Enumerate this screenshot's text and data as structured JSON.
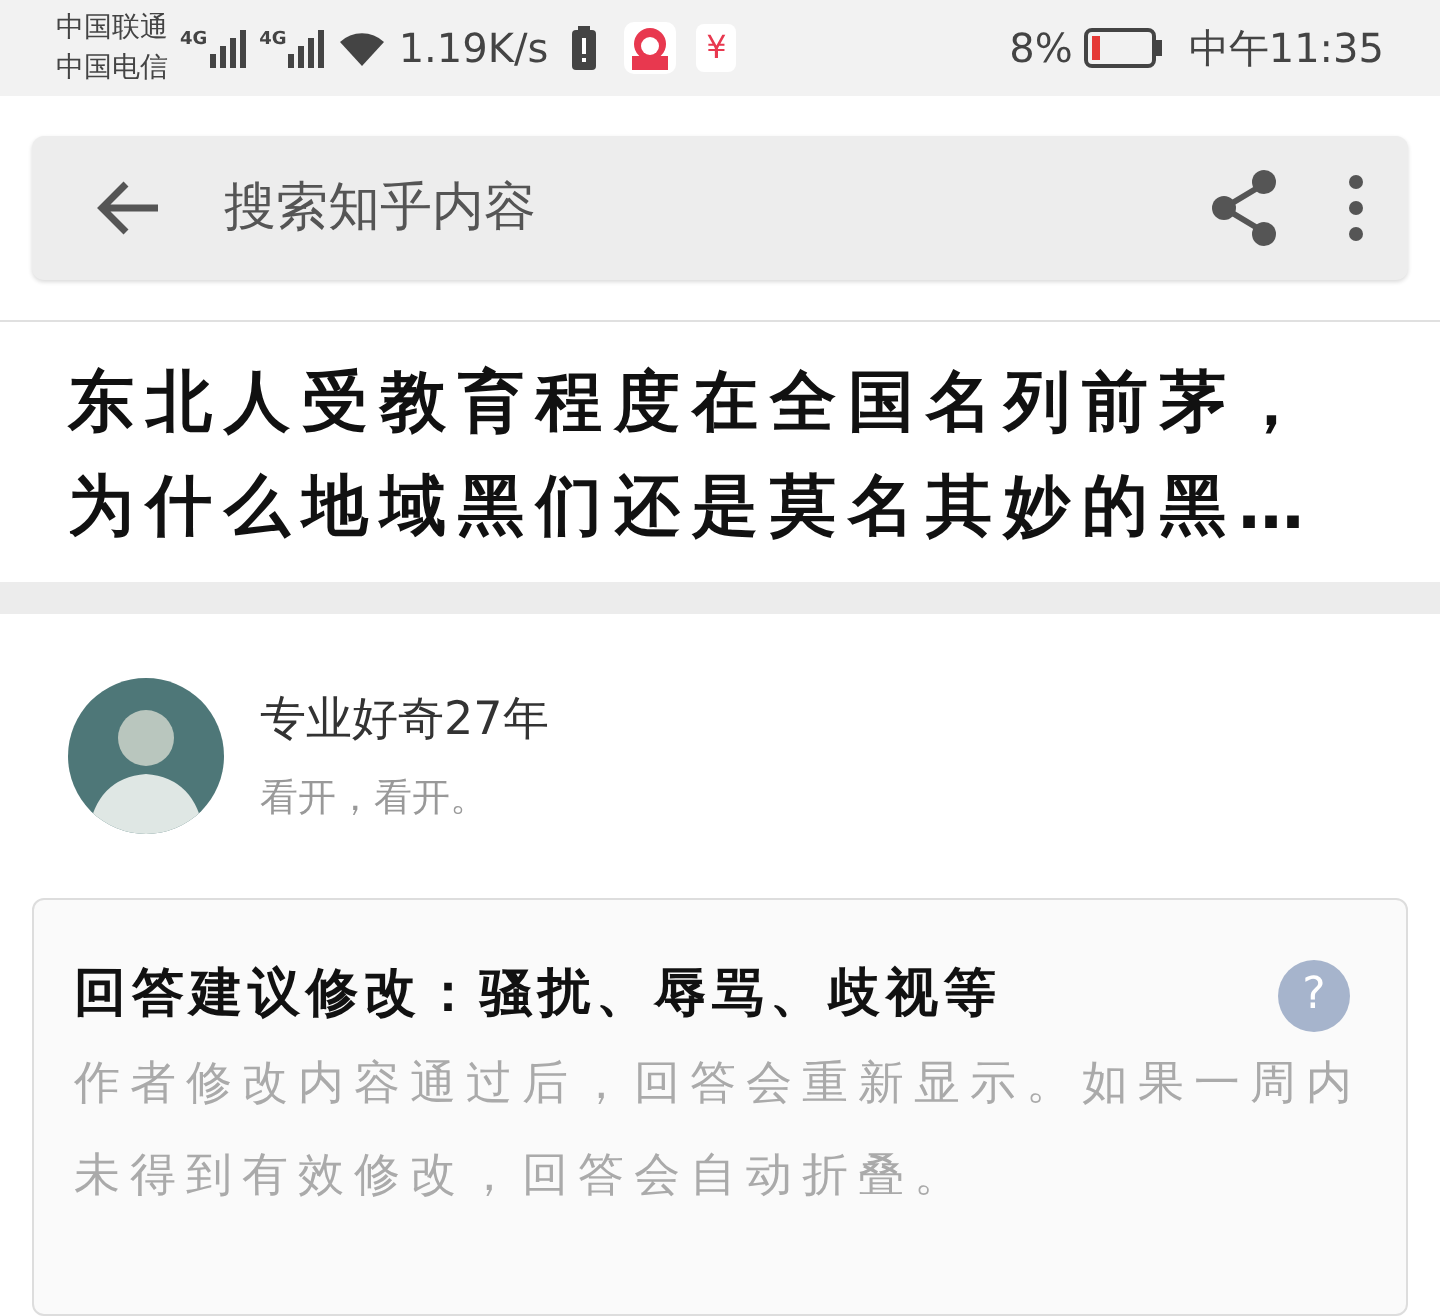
{
  "status_bar": {
    "carriers": [
      "中国联通",
      "中国电信"
    ],
    "network_labels": [
      "4G",
      "4G"
    ],
    "speed": "1.19K/s",
    "currency_glyph": "¥",
    "battery_percent": "8%",
    "time": "中午11:35"
  },
  "search": {
    "placeholder": "搜索知乎内容"
  },
  "question": {
    "title": "东北人受教育程度在全国名列前茅，为什么地域黑们还是莫名其妙的黑…"
  },
  "author": {
    "name": "专业好奇27年",
    "bio": "看开，看开。"
  },
  "notice": {
    "title": "回答建议修改：骚扰、辱骂、歧视等",
    "help_glyph": "?",
    "body": "作者修改内容通过后，回答会重新显示。如果一周内未得到有效修改，回答会自动折叠。"
  }
}
